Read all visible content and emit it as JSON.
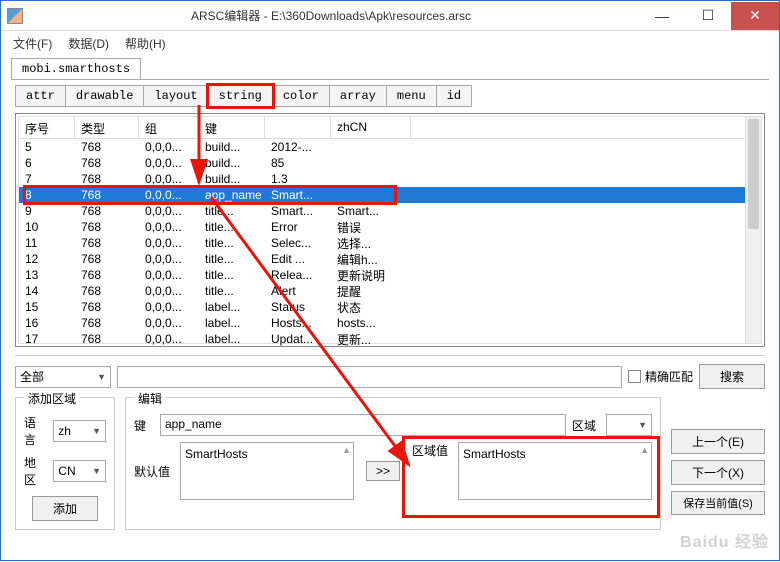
{
  "window": {
    "title": "ARSC编辑器 - E:\\360Downloads\\Apk\\resources.arsc"
  },
  "menubar": {
    "file": "文件(F)",
    "data": "数据(D)",
    "help": "帮助(H)"
  },
  "filetab": "mobi.smarthosts",
  "typetabs": [
    "attr",
    "drawable",
    "layout",
    "string",
    "color",
    "array",
    "menu",
    "id"
  ],
  "table": {
    "headers": {
      "seq": "序号",
      "type": "类型",
      "group": "组",
      "key": "键",
      "empty": "",
      "zhcn": "zhCN"
    },
    "rows": [
      {
        "seq": "5",
        "type": "768",
        "group": "0,0,0...",
        "key": "build...",
        "c5": "2012-...",
        "zhcn": ""
      },
      {
        "seq": "6",
        "type": "768",
        "group": "0,0,0...",
        "key": "build...",
        "c5": "85",
        "zhcn": ""
      },
      {
        "seq": "7",
        "type": "768",
        "group": "0,0,0...",
        "key": "build...",
        "c5": "1.3",
        "zhcn": ""
      },
      {
        "seq": "8",
        "type": "768",
        "group": "0,0,0...",
        "key": "app_name",
        "c5": "Smart...",
        "zhcn": "",
        "selected": true
      },
      {
        "seq": "9",
        "type": "768",
        "group": "0,0,0...",
        "key": "title...",
        "c5": "Smart...",
        "zhcn": "Smart..."
      },
      {
        "seq": "10",
        "type": "768",
        "group": "0,0,0...",
        "key": "title...",
        "c5": "Error",
        "zhcn": "错误"
      },
      {
        "seq": "11",
        "type": "768",
        "group": "0,0,0...",
        "key": "title...",
        "c5": "Selec...",
        "zhcn": "选择..."
      },
      {
        "seq": "12",
        "type": "768",
        "group": "0,0,0...",
        "key": "title...",
        "c5": "Edit ...",
        "zhcn": "编辑h..."
      },
      {
        "seq": "13",
        "type": "768",
        "group": "0,0,0...",
        "key": "title...",
        "c5": "Relea...",
        "zhcn": "更新说明"
      },
      {
        "seq": "14",
        "type": "768",
        "group": "0,0,0...",
        "key": "title...",
        "c5": "Alert",
        "zhcn": "提醒"
      },
      {
        "seq": "15",
        "type": "768",
        "group": "0,0,0...",
        "key": "label...",
        "c5": "Status",
        "zhcn": "状态"
      },
      {
        "seq": "16",
        "type": "768",
        "group": "0,0,0...",
        "key": "label...",
        "c5": "Hosts...",
        "zhcn": "hosts..."
      },
      {
        "seq": "17",
        "type": "768",
        "group": "0,0,0...",
        "key": "label...",
        "c5": "Updat...",
        "zhcn": "更新..."
      }
    ]
  },
  "search": {
    "all": "全部",
    "exact": "精确匹配",
    "btn": "搜索"
  },
  "add": {
    "title": "添加区域",
    "lang_label": "语言",
    "lang": "zh",
    "region_label": "地区",
    "region": "CN",
    "btn": "添加"
  },
  "edit": {
    "title": "编辑",
    "key_label": "键",
    "key": "app_name",
    "region_label": "区域",
    "default_label": "默认值",
    "default": "SmartHosts",
    "arrow_btn": ">>",
    "rvalue_label": "区域值",
    "rvalue": "SmartHosts"
  },
  "rbtns": {
    "prev": "上一个(E)",
    "next": "下一个(X)",
    "save": "保存当前值(S)"
  },
  "colors": {
    "highlight": "#e8150a",
    "selrow": "#1e7ad6"
  }
}
